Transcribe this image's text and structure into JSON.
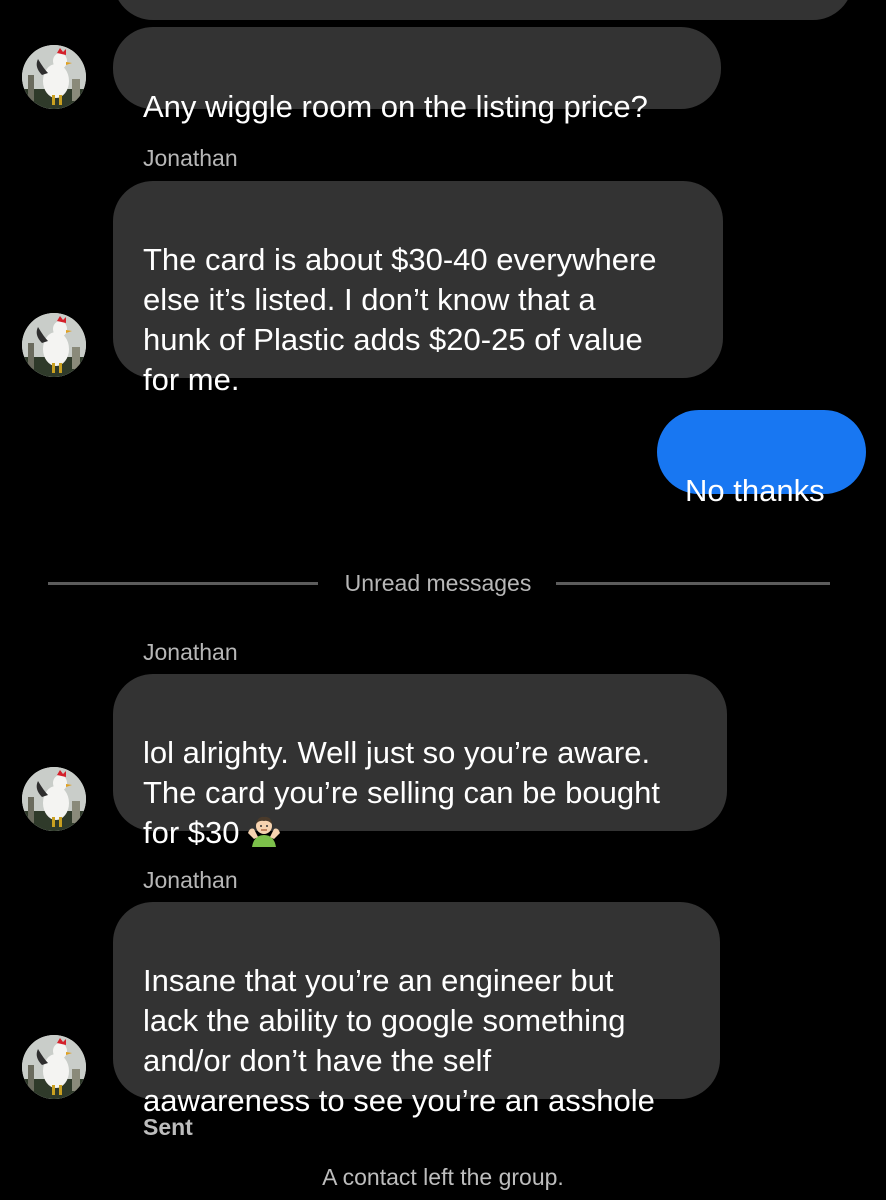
{
  "conversation": {
    "messages": [
      {
        "sender": "",
        "direction": "incoming",
        "text": "Any wiggle room on the listing price?",
        "avatar_icon": "rooster-avatar-icon"
      },
      {
        "sender": "Jonathan",
        "direction": "incoming",
        "text": "The card is about $30-40 everywhere\nelse it’s listed. I don’t know that a\nhunk of Plastic adds $20-25 of value\nfor me.",
        "avatar_icon": "rooster-avatar-icon"
      },
      {
        "sender": "",
        "direction": "outgoing",
        "text": "No thanks"
      },
      {
        "sender": "Jonathan",
        "direction": "incoming",
        "text": "lol alrighty. Well just so you’re aware.\nThe card you’re selling can be bought\nfor $30",
        "emoji": "person-shrugging-emoji",
        "avatar_icon": "rooster-avatar-icon"
      },
      {
        "sender": "Jonathan",
        "direction": "incoming",
        "text": "Insane that you’re an engineer but\nlack the ability to google something\nand/or don’t have the self\naawareness to see you’re an asshole",
        "avatar_icon": "rooster-avatar-icon"
      }
    ],
    "unread_divider": "Unread messages",
    "status": "Sent",
    "system_note": "A contact left the group."
  },
  "colors": {
    "background": "#000000",
    "incoming_bubble": "#333333",
    "outgoing_bubble": "#1877f2",
    "secondary_text": "#b7b7b7"
  }
}
